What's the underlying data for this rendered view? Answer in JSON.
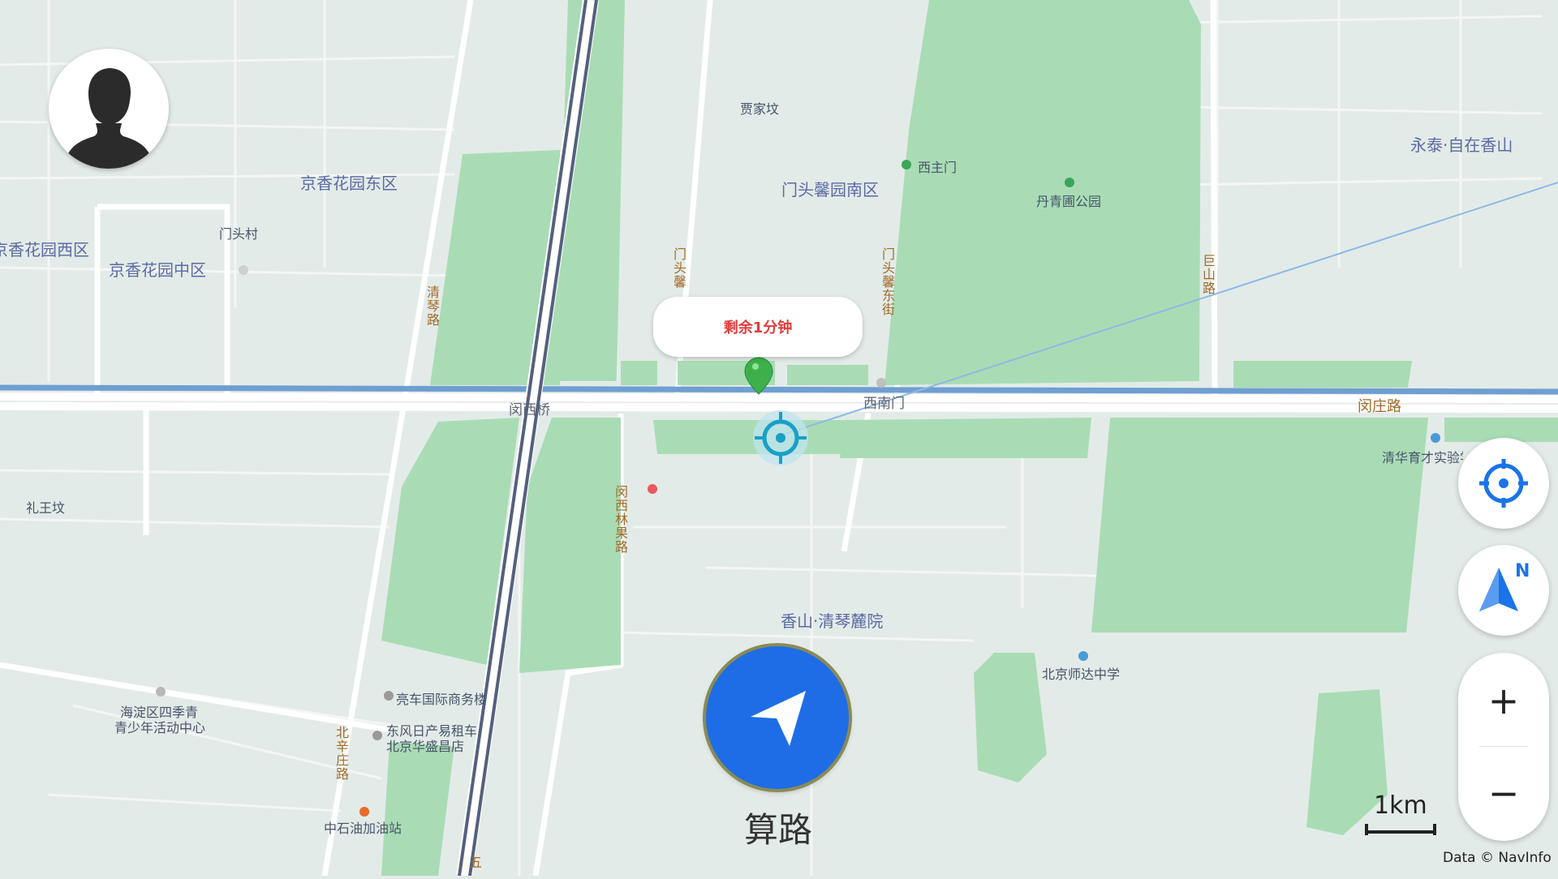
{
  "map": {
    "areas": [
      {
        "key": "jiajiafen",
        "text": "贾家坟"
      },
      {
        "key": "xizhumen",
        "text": "西主门"
      },
      {
        "key": "mentou_south",
        "text": "门头馨园南区"
      },
      {
        "key": "danqingpu_park",
        "text": "丹青圃公园"
      },
      {
        "key": "yongtai",
        "text": "永泰·自在香山"
      },
      {
        "key": "jingxiang_east",
        "text": "京香花园东区"
      },
      {
        "key": "jingxiang_west",
        "text": "京香花园西区"
      },
      {
        "key": "jingxiang_mid",
        "text": "京香花园中区"
      },
      {
        "key": "mentoucun",
        "text": "门头村"
      },
      {
        "key": "liwangfen",
        "text": "礼王坟"
      },
      {
        "key": "xiangshan_qingqin",
        "text": "香山·清琴麓院"
      },
      {
        "key": "beijing_shida",
        "text": "北京师达中学"
      },
      {
        "key": "qinghua_yucai",
        "text": "清华育才实验学校"
      },
      {
        "key": "haidian_youth_1",
        "text": "海淀区四季青"
      },
      {
        "key": "haidian_youth_2",
        "text": "青少年活动中心"
      },
      {
        "key": "liangche",
        "text": "亮车国际商务楼"
      },
      {
        "key": "dongfeng_1",
        "text": "东风日产易租车"
      },
      {
        "key": "dongfeng_2",
        "text": "北京华盛昌店"
      },
      {
        "key": "zhongshiyou",
        "text": "中石油加油站"
      },
      {
        "key": "xinanmen",
        "text": "西南门"
      },
      {
        "key": "minxiqiao",
        "text": "闵西桥"
      },
      {
        "key": "minzhuang_road",
        "text": "闵庄路"
      }
    ],
    "roads_vertical": [
      {
        "key": "qingqin_road",
        "text": "清琴路"
      },
      {
        "key": "mentouxin_road",
        "text": "门头馨"
      },
      {
        "key": "mentouxin_east",
        "text": "门头馨东街"
      },
      {
        "key": "jushan_road",
        "text": "巨山路"
      },
      {
        "key": "minxi_linguo",
        "text": "闵西林果路"
      },
      {
        "key": "beixinzhuang",
        "text": "北辛庄路"
      },
      {
        "key": "wu_partial",
        "text": "五"
      }
    ]
  },
  "avatar": {
    "icon": "user-silhouette-icon"
  },
  "tooltip": {
    "text": "剩余1分钟",
    "color": "#e33b3b"
  },
  "controls": {
    "locate_icon": "crosshair-locate-icon",
    "compass_icon": "north-arrow-icon",
    "compass_letter": "N",
    "zoom_in": "+",
    "zoom_out": "−"
  },
  "navigate": {
    "label": "算路",
    "icon": "navigation-arrow-icon",
    "color": "#1e6de6"
  },
  "scale": {
    "label": "1km"
  },
  "credit": "Data © NavInfo",
  "colors": {
    "background": "#e3ebe8",
    "park": "#a9dcb5",
    "road": "#ffffff",
    "river": "#6f9fd1",
    "rail": "#54607e",
    "accent": "#1a73e8"
  }
}
